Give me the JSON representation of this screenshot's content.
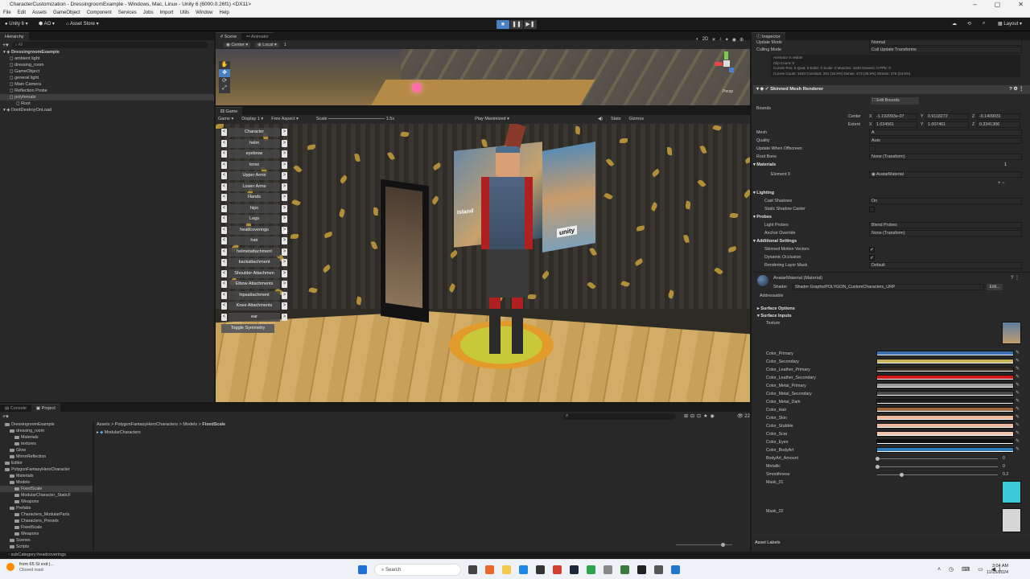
{
  "window": {
    "title": "CharacterCustomization - DressingroomExample - Windows, Mac, Linux - Unity 6 (6000.0.26f1) <DX11>"
  },
  "menu": [
    "File",
    "Edit",
    "Assets",
    "GameObject",
    "Component",
    "Services",
    "Jobs",
    "Import",
    "Utils",
    "Window",
    "Help"
  ],
  "toolbar": {
    "account": "Unity 6",
    "ao": "AO",
    "asset_store": "Asset Store",
    "layout": "Layout"
  },
  "hierarchy": {
    "tab": "Hierarchy",
    "search_placeholder": "All",
    "items": [
      {
        "label": "DressingroomExample",
        "depth": 0,
        "bold": true
      },
      {
        "label": "ambient light",
        "depth": 1
      },
      {
        "label": "dressing_room",
        "depth": 1
      },
      {
        "label": "GameObject",
        "depth": 1
      },
      {
        "label": "general light",
        "depth": 1
      },
      {
        "label": "Main Camera",
        "depth": 1
      },
      {
        "label": "Reflection Probe",
        "depth": 1
      },
      {
        "label": "polyfemale",
        "depth": 1,
        "selected": true
      },
      {
        "label": "Root",
        "depth": 2
      },
      {
        "label": "DontDestroyOnLoad",
        "depth": 0
      }
    ]
  },
  "scene": {
    "tabs": [
      "Scene",
      "Animator"
    ],
    "pivot": "Center",
    "space": "Local",
    "grid_value": "1",
    "persp": "Persp"
  },
  "game": {
    "tab": "Game",
    "display_mode": "Game",
    "display": "Display 1",
    "aspect": "Free Aspect",
    "scale_label": "Scale",
    "scale_value": "1.5x",
    "play_mode": "Play Maximized",
    "stats": "Stats",
    "gizmos": "Gizmos",
    "categories": [
      "Character",
      "helm",
      "eyebrow",
      "torso",
      "Upper Arms",
      "Lower Arms",
      "Hands",
      "hips",
      "Legs",
      "headcoverings",
      "hair",
      "helmetattachment",
      "backattachment",
      "Shoulder Attachmen",
      "Elbow Attachments",
      "hipsattachment",
      "Knee Attachments",
      "ear"
    ],
    "toggle": "Toggle Symmetry",
    "poster_text": "Island",
    "logo": "unity"
  },
  "bottom": {
    "tabs": [
      "Console",
      "Project"
    ],
    "breadcrumb": [
      "Assets",
      "PolygonFantasyHeroCharacters",
      "Models",
      "FixedScale"
    ],
    "content_items": [
      "ModularCharacters"
    ],
    "tree": [
      {
        "label": "DressingroomExample",
        "depth": 0
      },
      {
        "label": "dressing_room",
        "depth": 1
      },
      {
        "label": "Materials",
        "depth": 2
      },
      {
        "label": "textures",
        "depth": 2
      },
      {
        "label": "Glow",
        "depth": 1
      },
      {
        "label": "MirrorReflection",
        "depth": 1
      },
      {
        "label": "Editor",
        "depth": 0
      },
      {
        "label": "PolygonFantasyHeroCharacter",
        "depth": 0
      },
      {
        "label": "Materials",
        "depth": 1
      },
      {
        "label": "Models",
        "depth": 1
      },
      {
        "label": "FixedScale",
        "depth": 2,
        "selected": true
      },
      {
        "label": "ModularCharacter_StaticF",
        "depth": 2
      },
      {
        "label": "Weapons",
        "depth": 2
      },
      {
        "label": "Prefabs",
        "depth": 1
      },
      {
        "label": "Characters_ModularParts",
        "depth": 2
      },
      {
        "label": "Characters_Presets",
        "depth": 2
      },
      {
        "label": "FixedScale",
        "depth": 2
      },
      {
        "label": "Weapons",
        "depth": 2
      },
      {
        "label": "Scenes",
        "depth": 1
      },
      {
        "label": "Scripts",
        "depth": 1
      }
    ],
    "item_count": "22"
  },
  "status": {
    "text": "subCategory:headcoverings"
  },
  "inspector": {
    "tab": "Inspector",
    "update_mode_label": "Update Mode",
    "update_mode_value": "Normal",
    "culling_label": "Culling Mode",
    "culling_value": "Cull Update Transforms",
    "anim_info": [
      "Animator is visible",
      "Clip Count: 0",
      "Curves Pos: 0 Quat: 0 Euler: 0 Scale: 0 Muscles: 1840 Generic: 0 PPtr: 0",
      "Curves Count: 1840 Constant: 291 (15.9%) Dense: 473 (45.5%) Stream: 276 (24.5%)"
    ],
    "component": "Skinned Mesh Renderer",
    "edit_bounds": "Edit Bounds",
    "bounds_label": "Bounds",
    "center_label": "Center",
    "center": [
      "-1.192093e-07",
      "0.9118272",
      "-0.1409031"
    ],
    "extent_label": "Extent",
    "extent": [
      "1.024561",
      "1.007461",
      "0.3341306"
    ],
    "axes": [
      "X",
      "Y",
      "Z"
    ],
    "fields": [
      {
        "label": "Mesh",
        "value": "A"
      },
      {
        "label": "Quality",
        "value": "Auto"
      },
      {
        "label": "Update When Offscreen",
        "value": ""
      },
      {
        "label": "Root Bone",
        "value": "None (Transform)"
      }
    ],
    "materials_label": "Materials",
    "materials_count": "1",
    "element_label": "Element 0",
    "element_value": "AvatarMaterial",
    "lighting_label": "Lighting",
    "cast_shadows_label": "Cast Shadows",
    "cast_shadows_value": "On",
    "static_caster_label": "Static Shadow Caster",
    "probes_label": "Probes",
    "light_probes_label": "Light Probes",
    "light_probes_value": "Blend Probes",
    "anchor_label": "Anchor Override",
    "anchor_value": "None (Transform)",
    "additional_label": "Additional Settings",
    "motion_label": "Skinned Motion Vectors",
    "occlusion_label": "Dynamic Occlusion",
    "layer_mask_label": "Rendering Layer Mask",
    "layer_mask_value": "Default",
    "material_name": "AvatarMaterial (Material)",
    "shader_label": "Shader",
    "shader_value": "Shader Graphs/POLYGON_CustomCharacters_URP",
    "edit_btn": "Edit...",
    "addressable": "Addressable",
    "surface_options": "Surface Options",
    "surface_inputs": "Surface Inputs",
    "texture_label": "Texture",
    "colors": [
      {
        "name": "Color_Primary",
        "hex": "#3b6fb0"
      },
      {
        "name": "Color_Secondary",
        "hex": "#c8b25a"
      },
      {
        "name": "Color_Leather_Primary",
        "hex": "#3b2a1e"
      },
      {
        "name": "Color_Leather_Secondary",
        "hex": "#d01818"
      },
      {
        "name": "Color_Metal_Primary",
        "hex": "#9c9c9c"
      },
      {
        "name": "Color_Metal_Secondary",
        "hex": "#4a4a4a"
      },
      {
        "name": "Color_Metal_Dark",
        "hex": "#1c1c1c"
      },
      {
        "name": "Color_Hair",
        "hex": "#a3683c"
      },
      {
        "name": "Color_Skin",
        "hex": "#f0b89a"
      },
      {
        "name": "Color_Stubble",
        "hex": "#e8b89e"
      },
      {
        "name": "Color_Scar",
        "hex": "#f2c4ad"
      },
      {
        "name": "Color_Eyes",
        "hex": "#101010"
      },
      {
        "name": "Color_BodyArt",
        "hex": "#2a7cbf"
      }
    ],
    "sliders": [
      {
        "name": "BodyArt_Amount",
        "value": "0",
        "fraction": 0
      },
      {
        "name": "Metallic",
        "value": "0",
        "fraction": 0
      },
      {
        "name": "Smoothness",
        "value": "0.2",
        "fraction": 0.2
      }
    ],
    "mask01": "Mask_01",
    "mask02": "Mask_02",
    "asset_labels": "Asset Labels"
  },
  "taskbar": {
    "weather_temp": "from 65 St exit |...",
    "weather_sub": "Closed road",
    "search": "Search",
    "time": "3:04 AM",
    "date": "11/15/2024"
  }
}
